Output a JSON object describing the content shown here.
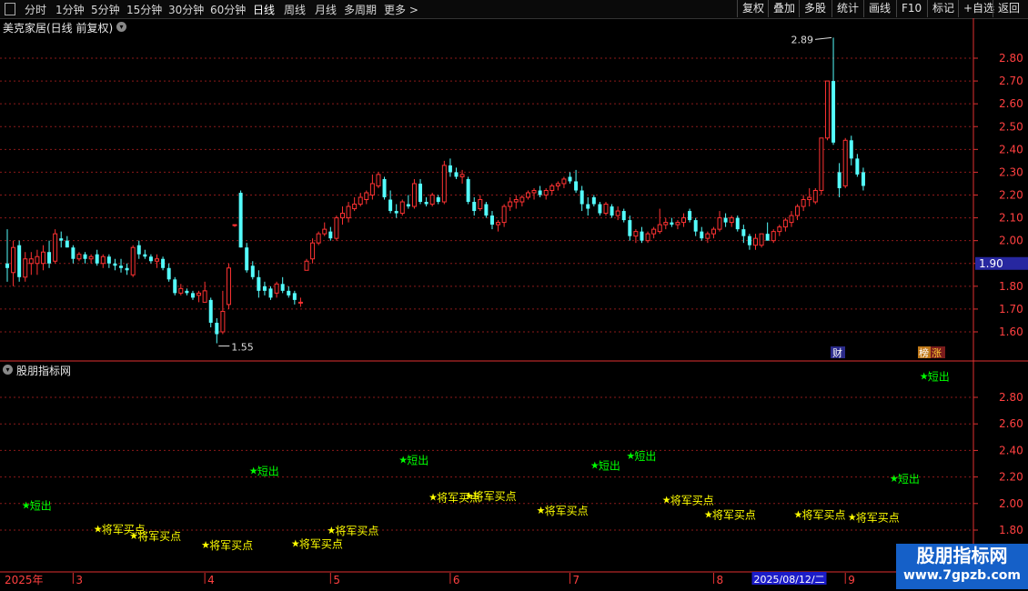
{
  "toolbar": {
    "periods": [
      "分时",
      "1分钟",
      "5分钟",
      "15分钟",
      "30分钟",
      "60分钟",
      "日线",
      "周线",
      "月线",
      "多周期",
      "更多 >"
    ],
    "active_period": "日线",
    "tools": [
      "复权",
      "叠加",
      "多股",
      "统计",
      "画线",
      "F10",
      "标记",
      "+自选",
      "返回"
    ]
  },
  "stock": {
    "title": "美克家居(日线 前复权)"
  },
  "indicator": {
    "title": "股朋指标网"
  },
  "watermark": {
    "line1": "股朋指标网",
    "line2": "www.7gpzb.com"
  },
  "badges": {
    "cai": "财",
    "bang": "榜",
    "zhang": "涨"
  },
  "colors": {
    "up": "#ff3232",
    "down": "#54fcfc",
    "grid": "#8b1a1a",
    "axis": "#e03030",
    "buy": "#ffff00",
    "sell": "#00ff00",
    "text": "#ff4040",
    "current_price_box": "#2727a0",
    "date_highlight": "#1c1cc8"
  },
  "chart_data": [
    {
      "type": "candlestick",
      "yticks": [
        1.6,
        1.7,
        1.8,
        1.9,
        2.0,
        2.1,
        2.2,
        2.3,
        2.4,
        2.5,
        2.6,
        2.7,
        2.8
      ],
      "ylim": [
        1.53,
        2.93
      ],
      "current_price": "1.90",
      "annotations": {
        "high": "2.89",
        "low": "1.55"
      },
      "candles": [
        {
          "o": 1.9,
          "h": 2.05,
          "l": 1.82,
          "c": 1.88
        },
        {
          "o": 1.86,
          "h": 2.0,
          "l": 1.8,
          "c": 1.97
        },
        {
          "o": 1.98,
          "h": 2.0,
          "l": 1.82,
          "c": 1.84
        },
        {
          "o": 1.84,
          "h": 1.95,
          "l": 1.82,
          "c": 1.92
        },
        {
          "o": 1.9,
          "h": 1.95,
          "l": 1.85,
          "c": 1.92
        },
        {
          "o": 1.9,
          "h": 1.96,
          "l": 1.85,
          "c": 1.93
        },
        {
          "o": 1.9,
          "h": 1.98,
          "l": 1.87,
          "c": 1.95
        },
        {
          "o": 1.95,
          "h": 2.0,
          "l": 1.88,
          "c": 1.9
        },
        {
          "o": 1.91,
          "h": 2.05,
          "l": 1.9,
          "c": 2.03
        },
        {
          "o": 2.01,
          "h": 2.04,
          "l": 1.97,
          "c": 2.0
        },
        {
          "o": 2.0,
          "h": 2.02,
          "l": 1.97,
          "c": 1.97
        },
        {
          "o": 1.97,
          "h": 1.98,
          "l": 1.9,
          "c": 1.92
        },
        {
          "o": 1.92,
          "h": 1.95,
          "l": 1.91,
          "c": 1.94
        },
        {
          "o": 1.94,
          "h": 1.95,
          "l": 1.9,
          "c": 1.92
        },
        {
          "o": 1.92,
          "h": 1.94,
          "l": 1.9,
          "c": 1.93
        },
        {
          "o": 1.94,
          "h": 1.96,
          "l": 1.89,
          "c": 1.9
        },
        {
          "o": 1.9,
          "h": 1.94,
          "l": 1.88,
          "c": 1.93
        },
        {
          "o": 1.93,
          "h": 1.94,
          "l": 1.88,
          "c": 1.9
        },
        {
          "o": 1.9,
          "h": 1.92,
          "l": 1.87,
          "c": 1.89
        },
        {
          "o": 1.89,
          "h": 1.92,
          "l": 1.86,
          "c": 1.88
        },
        {
          "o": 1.88,
          "h": 1.9,
          "l": 1.85,
          "c": 1.87
        },
        {
          "o": 1.85,
          "h": 1.98,
          "l": 1.84,
          "c": 1.97
        },
        {
          "o": 1.98,
          "h": 2.0,
          "l": 1.92,
          "c": 1.94
        },
        {
          "o": 1.94,
          "h": 1.96,
          "l": 1.92,
          "c": 1.93
        },
        {
          "o": 1.93,
          "h": 1.94,
          "l": 1.9,
          "c": 1.91
        },
        {
          "o": 1.91,
          "h": 1.94,
          "l": 1.88,
          "c": 1.92
        },
        {
          "o": 1.92,
          "h": 1.93,
          "l": 1.87,
          "c": 1.88
        },
        {
          "o": 1.88,
          "h": 1.9,
          "l": 1.82,
          "c": 1.83
        },
        {
          "o": 1.83,
          "h": 1.84,
          "l": 1.76,
          "c": 1.77
        },
        {
          "o": 1.77,
          "h": 1.81,
          "l": 1.76,
          "c": 1.79
        },
        {
          "o": 1.78,
          "h": 1.79,
          "l": 1.76,
          "c": 1.77
        },
        {
          "o": 1.77,
          "h": 1.78,
          "l": 1.74,
          "c": 1.75
        },
        {
          "o": 1.76,
          "h": 1.78,
          "l": 1.73,
          "c": 1.77
        },
        {
          "o": 1.73,
          "h": 1.82,
          "l": 1.73,
          "c": 1.78
        },
        {
          "o": 1.74,
          "h": 1.75,
          "l": 1.62,
          "c": 1.64
        },
        {
          "o": 1.64,
          "h": 1.66,
          "l": 1.55,
          "c": 1.59
        },
        {
          "o": 1.6,
          "h": 1.78,
          "l": 1.59,
          "c": 1.69
        },
        {
          "o": 1.72,
          "h": 1.9,
          "l": 1.7,
          "c": 1.88
        },
        {
          "o": 2.07,
          "h": 2.07,
          "l": 2.06,
          "c": 2.07
        },
        {
          "o": 2.21,
          "h": 2.22,
          "l": 1.97,
          "c": 1.97
        },
        {
          "o": 1.97,
          "h": 1.99,
          "l": 1.86,
          "c": 1.87
        },
        {
          "o": 1.89,
          "h": 1.91,
          "l": 1.83,
          "c": 1.84
        },
        {
          "o": 1.84,
          "h": 1.87,
          "l": 1.75,
          "c": 1.78
        },
        {
          "o": 1.8,
          "h": 1.82,
          "l": 1.76,
          "c": 1.78
        },
        {
          "o": 1.79,
          "h": 1.8,
          "l": 1.74,
          "c": 1.75
        },
        {
          "o": 1.77,
          "h": 1.82,
          "l": 1.75,
          "c": 1.81
        },
        {
          "o": 1.81,
          "h": 1.84,
          "l": 1.77,
          "c": 1.78
        },
        {
          "o": 1.78,
          "h": 1.8,
          "l": 1.75,
          "c": 1.76
        },
        {
          "o": 1.77,
          "h": 1.78,
          "l": 1.72,
          "c": 1.74
        },
        {
          "o": 1.73,
          "h": 1.75,
          "l": 1.71,
          "c": 1.73
        },
        {
          "o": 1.87,
          "h": 1.92,
          "l": 1.87,
          "c": 1.91
        },
        {
          "o": 1.92,
          "h": 2.01,
          "l": 1.9,
          "c": 1.99
        },
        {
          "o": 1.99,
          "h": 2.04,
          "l": 1.98,
          "c": 2.03
        },
        {
          "o": 2.03,
          "h": 2.08,
          "l": 2.02,
          "c": 2.05
        },
        {
          "o": 2.04,
          "h": 2.06,
          "l": 2.0,
          "c": 2.01
        },
        {
          "o": 2.01,
          "h": 2.11,
          "l": 2.0,
          "c": 2.1
        },
        {
          "o": 2.1,
          "h": 2.15,
          "l": 2.07,
          "c": 2.12
        },
        {
          "o": 2.1,
          "h": 2.17,
          "l": 2.08,
          "c": 2.15
        },
        {
          "o": 2.14,
          "h": 2.19,
          "l": 2.13,
          "c": 2.16
        },
        {
          "o": 2.16,
          "h": 2.21,
          "l": 2.15,
          "c": 2.19
        },
        {
          "o": 2.18,
          "h": 2.22,
          "l": 2.16,
          "c": 2.21
        },
        {
          "o": 2.2,
          "h": 2.29,
          "l": 2.18,
          "c": 2.25
        },
        {
          "o": 2.24,
          "h": 2.3,
          "l": 2.23,
          "c": 2.29
        },
        {
          "o": 2.27,
          "h": 2.28,
          "l": 2.18,
          "c": 2.19
        },
        {
          "o": 2.18,
          "h": 2.22,
          "l": 2.12,
          "c": 2.13
        },
        {
          "o": 2.13,
          "h": 2.16,
          "l": 2.1,
          "c": 2.12
        },
        {
          "o": 2.12,
          "h": 2.18,
          "l": 2.11,
          "c": 2.17
        },
        {
          "o": 2.16,
          "h": 2.2,
          "l": 2.14,
          "c": 2.15
        },
        {
          "o": 2.15,
          "h": 2.27,
          "l": 2.14,
          "c": 2.25
        },
        {
          "o": 2.25,
          "h": 2.27,
          "l": 2.16,
          "c": 2.17
        },
        {
          "o": 2.17,
          "h": 2.19,
          "l": 2.15,
          "c": 2.16
        },
        {
          "o": 2.16,
          "h": 2.21,
          "l": 2.15,
          "c": 2.2
        },
        {
          "o": 2.19,
          "h": 2.2,
          "l": 2.16,
          "c": 2.17
        },
        {
          "o": 2.17,
          "h": 2.35,
          "l": 2.16,
          "c": 2.33
        },
        {
          "o": 2.33,
          "h": 2.36,
          "l": 2.28,
          "c": 2.3
        },
        {
          "o": 2.3,
          "h": 2.32,
          "l": 2.27,
          "c": 2.28
        },
        {
          "o": 2.28,
          "h": 2.31,
          "l": 2.25,
          "c": 2.29
        },
        {
          "o": 2.27,
          "h": 2.28,
          "l": 2.16,
          "c": 2.17
        },
        {
          "o": 2.17,
          "h": 2.19,
          "l": 2.11,
          "c": 2.13
        },
        {
          "o": 2.14,
          "h": 2.2,
          "l": 2.13,
          "c": 2.18
        },
        {
          "o": 2.16,
          "h": 2.17,
          "l": 2.1,
          "c": 2.11
        },
        {
          "o": 2.11,
          "h": 2.13,
          "l": 2.05,
          "c": 2.07
        },
        {
          "o": 2.07,
          "h": 2.09,
          "l": 2.04,
          "c": 2.08
        },
        {
          "o": 2.08,
          "h": 2.16,
          "l": 2.06,
          "c": 2.15
        },
        {
          "o": 2.15,
          "h": 2.19,
          "l": 2.13,
          "c": 2.17
        },
        {
          "o": 2.17,
          "h": 2.2,
          "l": 2.14,
          "c": 2.18
        },
        {
          "o": 2.17,
          "h": 2.2,
          "l": 2.15,
          "c": 2.19
        },
        {
          "o": 2.19,
          "h": 2.22,
          "l": 2.18,
          "c": 2.21
        },
        {
          "o": 2.21,
          "h": 2.23,
          "l": 2.18,
          "c": 2.22
        },
        {
          "o": 2.22,
          "h": 2.24,
          "l": 2.19,
          "c": 2.2
        },
        {
          "o": 2.2,
          "h": 2.23,
          "l": 2.18,
          "c": 2.22
        },
        {
          "o": 2.22,
          "h": 2.25,
          "l": 2.2,
          "c": 2.24
        },
        {
          "o": 2.24,
          "h": 2.26,
          "l": 2.22,
          "c": 2.25
        },
        {
          "o": 2.25,
          "h": 2.28,
          "l": 2.23,
          "c": 2.27
        },
        {
          "o": 2.28,
          "h": 2.3,
          "l": 2.25,
          "c": 2.26
        },
        {
          "o": 2.26,
          "h": 2.31,
          "l": 2.21,
          "c": 2.22
        },
        {
          "o": 2.22,
          "h": 2.24,
          "l": 2.13,
          "c": 2.16
        },
        {
          "o": 2.16,
          "h": 2.19,
          "l": 2.11,
          "c": 2.14
        },
        {
          "o": 2.19,
          "h": 2.2,
          "l": 2.15,
          "c": 2.16
        },
        {
          "o": 2.16,
          "h": 2.17,
          "l": 2.11,
          "c": 2.12
        },
        {
          "o": 2.12,
          "h": 2.17,
          "l": 2.11,
          "c": 2.16
        },
        {
          "o": 2.15,
          "h": 2.16,
          "l": 2.1,
          "c": 2.11
        },
        {
          "o": 2.11,
          "h": 2.15,
          "l": 2.09,
          "c": 2.13
        },
        {
          "o": 2.13,
          "h": 2.14,
          "l": 2.08,
          "c": 2.09
        },
        {
          "o": 2.09,
          "h": 2.11,
          "l": 2.0,
          "c": 2.02
        },
        {
          "o": 2.02,
          "h": 2.05,
          "l": 1.99,
          "c": 2.04
        },
        {
          "o": 2.04,
          "h": 2.06,
          "l": 1.99,
          "c": 2.0
        },
        {
          "o": 2.0,
          "h": 2.04,
          "l": 1.99,
          "c": 2.03
        },
        {
          "o": 2.03,
          "h": 2.06,
          "l": 2.01,
          "c": 2.05
        },
        {
          "o": 2.04,
          "h": 2.14,
          "l": 2.03,
          "c": 2.07
        },
        {
          "o": 2.07,
          "h": 2.1,
          "l": 2.05,
          "c": 2.08
        },
        {
          "o": 2.08,
          "h": 2.1,
          "l": 2.06,
          "c": 2.07
        },
        {
          "o": 2.07,
          "h": 2.09,
          "l": 2.05,
          "c": 2.08
        },
        {
          "o": 2.08,
          "h": 2.12,
          "l": 2.06,
          "c": 2.1
        },
        {
          "o": 2.13,
          "h": 2.14,
          "l": 2.08,
          "c": 2.09
        },
        {
          "o": 2.09,
          "h": 2.1,
          "l": 2.02,
          "c": 2.04
        },
        {
          "o": 2.04,
          "h": 2.06,
          "l": 2.0,
          "c": 2.01
        },
        {
          "o": 2.01,
          "h": 2.04,
          "l": 1.99,
          "c": 2.03
        },
        {
          "o": 2.03,
          "h": 2.06,
          "l": 2.01,
          "c": 2.05
        },
        {
          "o": 2.05,
          "h": 2.13,
          "l": 2.04,
          "c": 2.1
        },
        {
          "o": 2.1,
          "h": 2.12,
          "l": 2.06,
          "c": 2.08
        },
        {
          "o": 2.08,
          "h": 2.11,
          "l": 2.06,
          "c": 2.1
        },
        {
          "o": 2.1,
          "h": 2.11,
          "l": 2.04,
          "c": 2.05
        },
        {
          "o": 2.05,
          "h": 2.07,
          "l": 1.99,
          "c": 2.02
        },
        {
          "o": 2.02,
          "h": 2.03,
          "l": 1.96,
          "c": 1.98
        },
        {
          "o": 1.98,
          "h": 2.03,
          "l": 1.96,
          "c": 2.01
        },
        {
          "o": 1.98,
          "h": 2.03,
          "l": 1.97,
          "c": 2.03
        },
        {
          "o": 2.03,
          "h": 2.08,
          "l": 2.0,
          "c": 2.0
        },
        {
          "o": 2.0,
          "h": 2.05,
          "l": 1.99,
          "c": 2.04
        },
        {
          "o": 2.04,
          "h": 2.07,
          "l": 2.02,
          "c": 2.06
        },
        {
          "o": 2.06,
          "h": 2.1,
          "l": 2.04,
          "c": 2.09
        },
        {
          "o": 2.08,
          "h": 2.13,
          "l": 2.06,
          "c": 2.11
        },
        {
          "o": 2.11,
          "h": 2.16,
          "l": 2.09,
          "c": 2.15
        },
        {
          "o": 2.15,
          "h": 2.2,
          "l": 2.13,
          "c": 2.18
        },
        {
          "o": 2.18,
          "h": 2.23,
          "l": 2.15,
          "c": 2.19
        },
        {
          "o": 2.17,
          "h": 2.23,
          "l": 2.16,
          "c": 2.22
        },
        {
          "o": 2.22,
          "h": 2.45,
          "l": 2.2,
          "c": 2.45
        },
        {
          "o": 2.45,
          "h": 2.7,
          "l": 2.44,
          "c": 2.7
        },
        {
          "o": 2.7,
          "h": 2.89,
          "l": 2.42,
          "c": 2.43
        },
        {
          "o": 2.3,
          "h": 2.34,
          "l": 2.19,
          "c": 2.23
        },
        {
          "o": 2.24,
          "h": 2.45,
          "l": 2.23,
          "c": 2.44
        },
        {
          "o": 2.44,
          "h": 2.46,
          "l": 2.33,
          "c": 2.36
        },
        {
          "o": 2.36,
          "h": 2.38,
          "l": 2.28,
          "c": 2.29
        },
        {
          "o": 2.3,
          "h": 2.32,
          "l": 2.22,
          "c": 2.24
        }
      ]
    },
    {
      "type": "scatter",
      "yticks": [
        1.8,
        2.0,
        2.2,
        2.4,
        2.6,
        2.8
      ],
      "ylim": [
        1.69,
        2.99
      ],
      "signals": [
        {
          "i": 3,
          "label": "短出",
          "y": 1.99,
          "kind": "sell"
        },
        {
          "i": 15,
          "label": "将军买点",
          "y": 1.81,
          "kind": "buy"
        },
        {
          "i": 21,
          "label": "将军买点",
          "y": 1.76,
          "kind": "buy"
        },
        {
          "i": 33,
          "label": "将军买点",
          "y": 1.69,
          "kind": "buy"
        },
        {
          "i": 41,
          "label": "短出",
          "y": 2.25,
          "kind": "sell"
        },
        {
          "i": 48,
          "label": "将军买点",
          "y": 1.7,
          "kind": "buy"
        },
        {
          "i": 54,
          "label": "将军买点",
          "y": 1.8,
          "kind": "buy"
        },
        {
          "i": 66,
          "label": "短出",
          "y": 2.33,
          "kind": "sell"
        },
        {
          "i": 71,
          "label": "将军买点",
          "y": 2.05,
          "kind": "buy"
        },
        {
          "i": 77,
          "label": "将军买点",
          "y": 2.06,
          "kind": "buy"
        },
        {
          "i": 89,
          "label": "将军买点",
          "y": 1.95,
          "kind": "buy"
        },
        {
          "i": 98,
          "label": "短出",
          "y": 2.29,
          "kind": "sell"
        },
        {
          "i": 104,
          "label": "短出",
          "y": 2.36,
          "kind": "sell"
        },
        {
          "i": 110,
          "label": "将军买点",
          "y": 2.03,
          "kind": "buy"
        },
        {
          "i": 117,
          "label": "将军买点",
          "y": 1.92,
          "kind": "buy"
        },
        {
          "i": 132,
          "label": "将军买点",
          "y": 1.92,
          "kind": "buy"
        },
        {
          "i": 141,
          "label": "将军买点",
          "y": 1.9,
          "kind": "buy"
        },
        {
          "i": 148,
          "label": "短出",
          "y": 2.19,
          "kind": "sell"
        },
        {
          "i": 153,
          "label": "短出",
          "y": 2.96,
          "kind": "sell"
        }
      ]
    }
  ],
  "xaxis": {
    "labels": [
      {
        "i": 0,
        "text": "2025年"
      },
      {
        "i": 11,
        "text": "3"
      },
      {
        "i": 33,
        "text": "4"
      },
      {
        "i": 54,
        "text": "5"
      },
      {
        "i": 74,
        "text": "6"
      },
      {
        "i": 94,
        "text": "7"
      },
      {
        "i": 118,
        "text": "8"
      },
      {
        "i": 140,
        "text": "9"
      }
    ],
    "highlight": {
      "i": 125,
      "text": "2025/08/12/二"
    }
  }
}
